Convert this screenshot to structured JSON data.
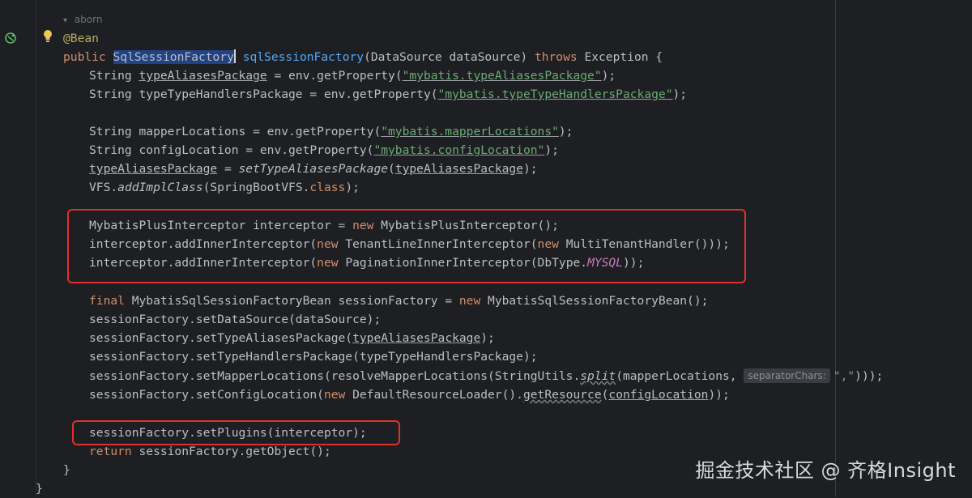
{
  "author": "aborn",
  "lines": {
    "l0": "@Bean",
    "l1_kw": "public",
    "l1_type": "SqlSessionFactory",
    "l1_name": "sqlSessionFactory",
    "l1_args": "(DataSource dataSource) ",
    "l1_throws": "throws",
    "l1_end": " Exception {",
    "l2_a": "String ",
    "l2_var": "typeAliasesPackage",
    "l2_b": " = env.getProperty(",
    "l2_str": "\"mybatis.typeAliasesPackage\"",
    "l2_c": ");",
    "l3_a": "String typeTypeHandlersPackage = env.getProperty(",
    "l3_str": "\"mybatis.typeTypeHandlersPackage\"",
    "l3_c": ");",
    "l5_a": "String mapperLocations = env.getProperty(",
    "l5_str": "\"mybatis.mapperLocations\"",
    "l5_c": ");",
    "l6_a": "String configLocation = env.getProperty(",
    "l6_str": "\"mybatis.configLocation\"",
    "l6_c": ");",
    "l7_var": "typeAliasesPackage",
    "l7_b": " = ",
    "l7_fn": "setTypeAliasesPackage",
    "l7_c": "(",
    "l7_var2": "typeAliasesPackage",
    "l7_d": ");",
    "l8_a": "VFS.",
    "l8_fn": "addImplClass",
    "l8_b": "(SpringBootVFS.",
    "l8_kw": "class",
    "l8_c": ");",
    "l10_a": "MybatisPlusInterceptor interceptor = ",
    "l10_kw": "new",
    "l10_b": " MybatisPlusInterceptor();",
    "l11_a": "interceptor.addInnerInterceptor(",
    "l11_kw": "new",
    "l11_b": " TenantLineInnerInterceptor(",
    "l11_kw2": "new",
    "l11_c": " MultiTenantHandler()));",
    "l12_a": "interceptor.addInnerInterceptor(",
    "l12_kw": "new",
    "l12_b": " PaginationInnerInterceptor(DbType.",
    "l12_field": "MYSQL",
    "l12_c": "));",
    "l14_kw": "final",
    "l14_a": " MybatisSqlSessionFactoryBean sessionFactory = ",
    "l14_kw2": "new",
    "l14_b": " MybatisSqlSessionFactoryBean();",
    "l15": "sessionFactory.setDataSource(dataSource);",
    "l16_a": "sessionFactory.setTypeAliasesPackage(",
    "l16_var": "typeAliasesPackage",
    "l16_b": ");",
    "l17": "sessionFactory.setTypeHandlersPackage(typeTypeHandlersPackage);",
    "l18_a": "sessionFactory.setMapperLocations(resolveMapperLocations(StringUtils.",
    "l18_fn": "split",
    "l18_b": "(mapperLocations, ",
    "l18_hint": "separatorChars:",
    "l18_str": "\",\"",
    "l18_c": ")));",
    "l19_a": "sessionFactory.setConfigLocation(",
    "l19_kw": "new",
    "l19_b": " DefaultResourceLoader().",
    "l19_fn": "getResource",
    "l19_c": "(",
    "l19_var": "configLocation",
    "l19_d": "));",
    "l21": "sessionFactory.setPlugins(interceptor);",
    "l22_kw": "return",
    "l22_a": " sessionFactory.getObject();",
    "l23": "}",
    "l24": "}"
  },
  "watermark": "掘金技术社区 @ 齐格Insight",
  "colors": {
    "background": "#1e1f22",
    "keyword": "#cf8e6d",
    "string": "#6aab73",
    "annotation": "#b3ae60",
    "highlight_box": "#e0302a"
  },
  "icons": {
    "gutter_run": "run-bean-icon",
    "intention": "lightbulb-icon"
  }
}
